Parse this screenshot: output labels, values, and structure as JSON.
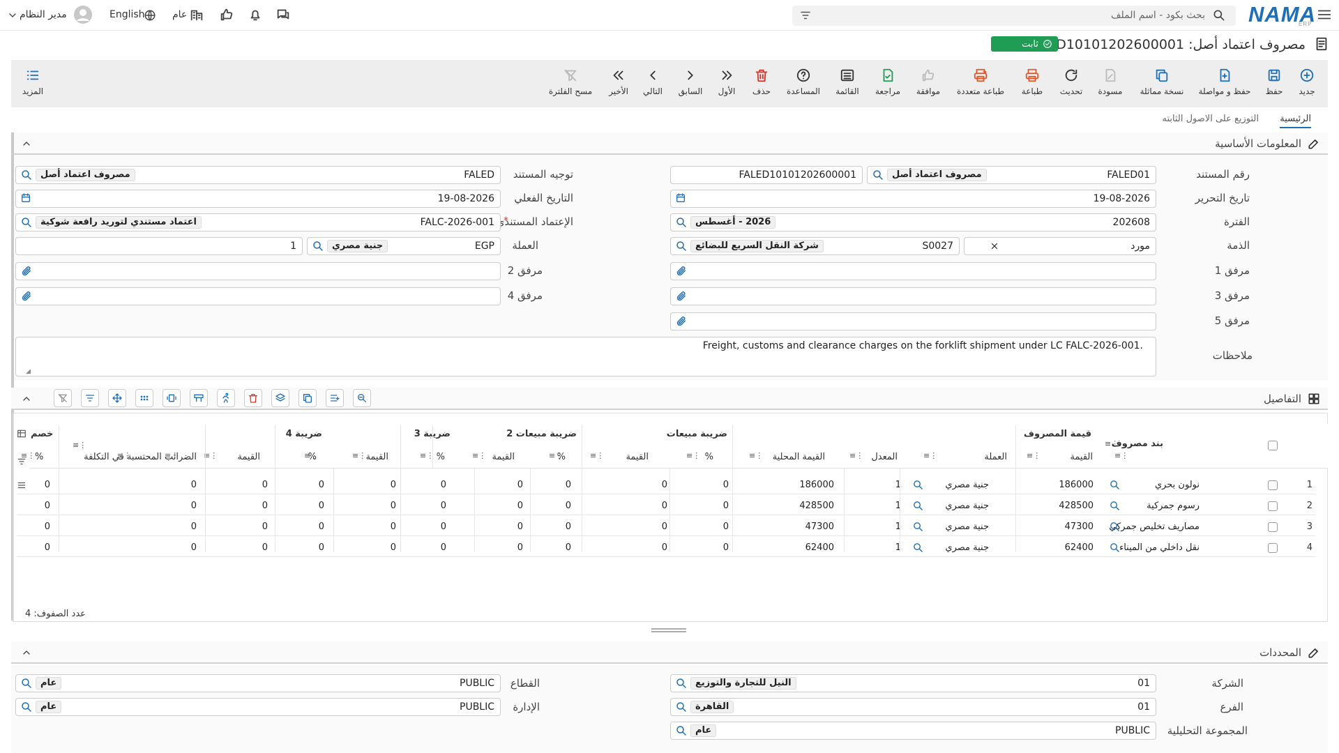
{
  "topbar": {
    "search_placeholder": "بحث بكود - اسم الملف",
    "logo": "NAMA",
    "logo_sub": "ERP",
    "company": "عام",
    "language": "English",
    "user": "مدير النظام"
  },
  "title": "مصروف اعتماد أصل: FALED10101202600001",
  "status_badge": "ثابت",
  "toolbar": [
    {
      "label": "جديد",
      "icon": "plus-circle-icon",
      "color": "#1e6fb8",
      "enabled": true
    },
    {
      "label": "حفظ",
      "icon": "save-icon",
      "color": "#1e6fb8",
      "enabled": true
    },
    {
      "label": "حفظ و مواصلة",
      "icon": "save-add-icon",
      "color": "#1e6fb8",
      "enabled": true
    },
    {
      "label": "نسخة مماثلة",
      "icon": "copy-icon",
      "color": "#1e6fb8",
      "enabled": true
    },
    {
      "label": "مسودة",
      "icon": "draft-icon",
      "color": "#bbbbbb",
      "enabled": false
    },
    {
      "label": "تحديث",
      "icon": "refresh-icon",
      "color": "#333333",
      "enabled": true
    },
    {
      "label": "طباعة",
      "icon": "print-icon",
      "color": "#e0592a",
      "enabled": true
    },
    {
      "label": "طباعة متعددة",
      "icon": "multi-print-icon",
      "color": "#e0592a",
      "enabled": true
    },
    {
      "label": "موافقة",
      "icon": "thumbs-up-icon",
      "color": "#bbbbbb",
      "enabled": false
    },
    {
      "label": "مراجعة",
      "icon": "review-icon",
      "color": "#1f9d55",
      "enabled": true
    },
    {
      "label": "القائمة",
      "icon": "list-icon",
      "color": "#333333",
      "enabled": true
    },
    {
      "label": "المساعدة",
      "icon": "help-icon",
      "color": "#333333",
      "enabled": true
    },
    {
      "label": "حذف",
      "icon": "trash-icon",
      "color": "#d9362b",
      "enabled": true
    },
    {
      "label": "الأول",
      "icon": "first-icon",
      "color": "#333333",
      "enabled": true
    },
    {
      "label": "السابق",
      "icon": "prev-icon",
      "color": "#333333",
      "enabled": true
    },
    {
      "label": "التالي",
      "icon": "next-icon",
      "color": "#333333",
      "enabled": true
    },
    {
      "label": "الأخير",
      "icon": "last-icon",
      "color": "#333333",
      "enabled": true
    },
    {
      "label": "مسح الفلترة",
      "icon": "clear-filter-icon",
      "color": "#bbbbbb",
      "enabled": false
    }
  ],
  "more_label": "المزيد",
  "tabs": [
    "الرئيسية",
    "التوزيع على الاصول الثابته"
  ],
  "basic": {
    "title": "المعلومات الأساسية",
    "doc_number_label": "رقم المستند",
    "doc_number_code": "FALED01",
    "doc_type_chip": "مصروف اعتماد أصل",
    "doc_number_value": "FALED10101202600001",
    "direction_label": "توجيه المستند",
    "direction_code": "FALED",
    "direction_chip": "مصروف اعتماد أصل",
    "edit_date_label": "تاريخ التحرير",
    "edit_date": "19-08-2026",
    "actual_date_label": "التاريخ الفعلي",
    "actual_date": "19-08-2026",
    "period_label": "الفترة",
    "period_code": "202608",
    "period_chip": "2026 - أغسطس",
    "lc_label": "الإعتماد المستندي",
    "lc_code": "FALC-2026-001",
    "lc_chip": "اعتماد مستندي لتوريد رافعة شوكية",
    "party_label": "الذمة",
    "party_type": "مورد",
    "party_code": "S0027",
    "party_chip": "شركة النقل السريع للبضائع",
    "currency_label": "العملة",
    "currency_code": "EGP",
    "currency_chip": "جنية مصري",
    "currency_rate": "1",
    "att1_label": "مرفق 1",
    "att2_label": "مرفق 2",
    "att3_label": "مرفق 3",
    "att4_label": "مرفق 4",
    "att5_label": "مرفق 5",
    "notes_label": "ملاحظات",
    "notes": "Freight, customs and clearance charges on the forklift shipment under LC FALC-2026-001."
  },
  "details": {
    "title": "التفاصيل",
    "groups": [
      "بند مصروف",
      "قيمة المصروف",
      "ضريبة مبيعات",
      "ضريبة مبيعات 2",
      "ضريبة 3",
      "ضريبة 4",
      "خصم"
    ],
    "subheaders": [
      "القيمة",
      "العملة",
      "المعدل",
      "القيمة المحلية",
      "%",
      "القيمة",
      "%",
      "القيمة",
      "%",
      "القيمة",
      "%",
      "القيمة",
      "الضرائب المحتسبة في التكلفة",
      "%"
    ],
    "rows": [
      {
        "n": "1",
        "item": "نولون بحري",
        "value": "186000",
        "currency": "جنية مصري",
        "rate": "1",
        "local": "186000",
        "t1p": "0",
        "t1v": "0",
        "t2p": "0",
        "t2v": "0",
        "t3p": "0",
        "t3v": "0",
        "t4p": "0",
        "t4v": "0",
        "taxcost": "0",
        "disc": "0"
      },
      {
        "n": "2",
        "item": "رسوم جمركية",
        "value": "428500",
        "currency": "جنية مصري",
        "rate": "1",
        "local": "428500",
        "t1p": "0",
        "t1v": "0",
        "t2p": "0",
        "t2v": "0",
        "t3p": "0",
        "t3v": "0",
        "t4p": "0",
        "t4v": "0",
        "taxcost": "0",
        "disc": "0"
      },
      {
        "n": "3",
        "item": "مصاريف تخليص جمركي",
        "value": "47300",
        "currency": "جنية مصري",
        "rate": "1",
        "local": "47300",
        "t1p": "0",
        "t1v": "0",
        "t2p": "0",
        "t2v": "0",
        "t3p": "0",
        "t3v": "0",
        "t4p": "0",
        "t4v": "0",
        "taxcost": "0",
        "disc": "0"
      },
      {
        "n": "4",
        "item": "نقل داخلي من الميناء",
        "value": "62400",
        "currency": "جنية مصري",
        "rate": "1",
        "local": "62400",
        "t1p": "0",
        "t1v": "0",
        "t2p": "0",
        "t2v": "0",
        "t3p": "0",
        "t3v": "0",
        "t4p": "0",
        "t4v": "0",
        "taxcost": "0",
        "disc": "0"
      }
    ],
    "row_count": "عدد الصفوف: 4"
  },
  "dims": {
    "title": "المحددات",
    "company_label": "الشركة",
    "company_code": "01",
    "company_chip": "النيل للتجارة والتوزيع",
    "sector_label": "القطاع",
    "sector_code": "PUBLIC",
    "sector_chip": "عام",
    "branch_label": "الفرع",
    "branch_code": "01",
    "branch_chip": "القاهرة",
    "dept_label": "الإدارة",
    "dept_code": "PUBLIC",
    "dept_chip": "عام",
    "group_label": "المجموعة التحليلية",
    "group_code": "PUBLIC",
    "group_chip": "عام"
  }
}
